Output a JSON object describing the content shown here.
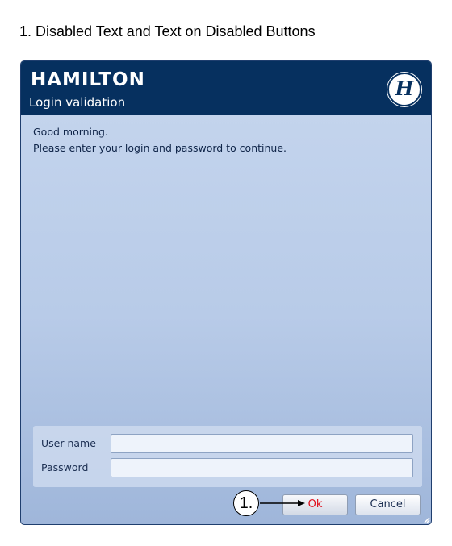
{
  "document": {
    "heading": "1. Disabled Text and Text on Disabled Buttons"
  },
  "window": {
    "logo_text": "HAMILTON",
    "title": "Login validation",
    "brand_monogram": "H"
  },
  "message": {
    "greeting": "Good morning.",
    "instruction": "Please enter your login and password to continue."
  },
  "login": {
    "username_label": "User name",
    "username_value": "",
    "password_label": "Password",
    "password_value": ""
  },
  "buttons": {
    "ok_label": "Ok",
    "cancel_label": "Cancel"
  },
  "annotation": {
    "callout_label": "1."
  },
  "colors": {
    "titlebar": "#06305f",
    "disabled_text": "#e00d1a",
    "body_gradient_top": "#c6d6ee",
    "body_gradient_bottom": "#9fb6da"
  },
  "icons": {
    "brand": "hamilton-monogram-icon",
    "arrow": "callout-arrow-icon",
    "grip": "resize-grip-icon"
  }
}
